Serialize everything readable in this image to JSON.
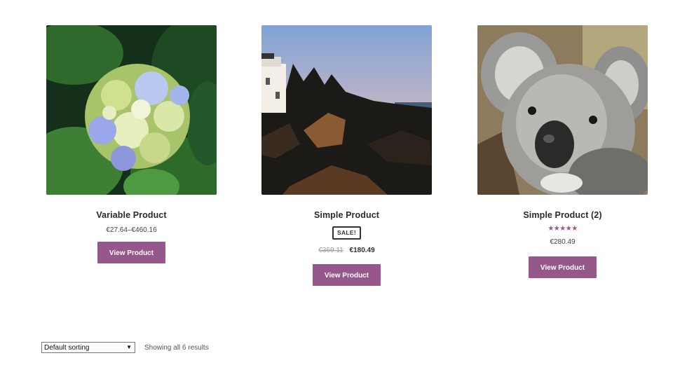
{
  "products": [
    {
      "title": "Variable Product",
      "price": "€27.64–€460.16",
      "button_label": "View Product",
      "image": "hydrangea-flower"
    },
    {
      "title": "Simple Product",
      "badge": "SALE!",
      "old_price": "€369.11",
      "new_price": "€180.49",
      "button_label": "View Product",
      "image": "lighthouse-coast-sunset"
    },
    {
      "title": "Simple Product (2)",
      "rating": 5,
      "rating_stars": "★★★★★",
      "price": "€280.49",
      "button_label": "View Product",
      "image": "koala"
    }
  ],
  "toolbar": {
    "sorting_value": "Default sorting",
    "result_count": "Showing all 6 results"
  },
  "colors": {
    "accent": "#96588a",
    "text_dark": "#2b2b2b"
  }
}
